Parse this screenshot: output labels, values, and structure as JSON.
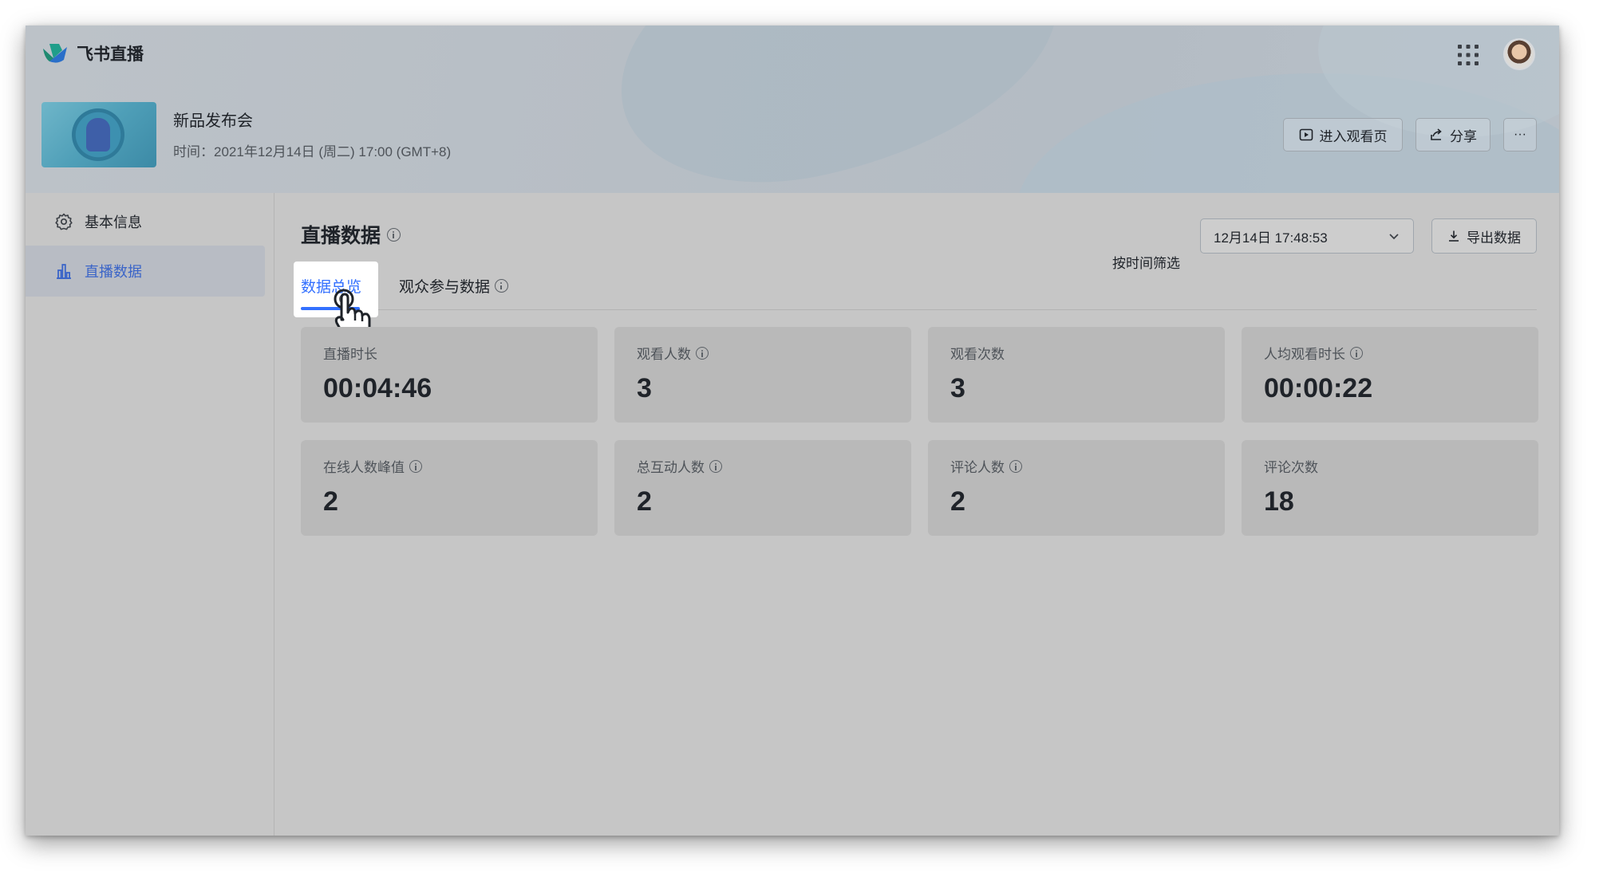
{
  "app": {
    "name": "飞书直播"
  },
  "event": {
    "title": "新品发布会",
    "time_label": "时间：",
    "time_value": "2021年12月14日 (周二) 17:00 (GMT+8)"
  },
  "header_buttons": {
    "enter": "进入观看页",
    "share": "分享",
    "more": "···"
  },
  "sidebar": {
    "items": [
      {
        "label": "基本信息",
        "icon": "gear-icon"
      },
      {
        "label": "直播数据",
        "icon": "bar-chart-icon",
        "active": true
      }
    ]
  },
  "main": {
    "title": "直播数据",
    "filter_label": "按时间筛选",
    "filter_value": "12月14日 17:48:53",
    "export_label": "导出数据",
    "tabs": [
      {
        "label": "数据总览",
        "active": true
      },
      {
        "label": "观众参与数据"
      }
    ]
  },
  "stats": [
    {
      "label": "直播时长",
      "value": "00:04:46",
      "info": false
    },
    {
      "label": "观看人数",
      "value": "3",
      "info": true
    },
    {
      "label": "观看次数",
      "value": "3",
      "info": false
    },
    {
      "label": "人均观看时长",
      "value": "00:00:22",
      "info": true
    },
    {
      "label": "在线人数峰值",
      "value": "2",
      "info": true
    },
    {
      "label": "总互动人数",
      "value": "2",
      "info": true
    },
    {
      "label": "评论人数",
      "value": "2",
      "info": true
    },
    {
      "label": "评论次数",
      "value": "18",
      "info": false
    }
  ],
  "colors": {
    "accent": "#3370ff",
    "brand_blue": "#3a64c8",
    "text": "#1f2329"
  }
}
